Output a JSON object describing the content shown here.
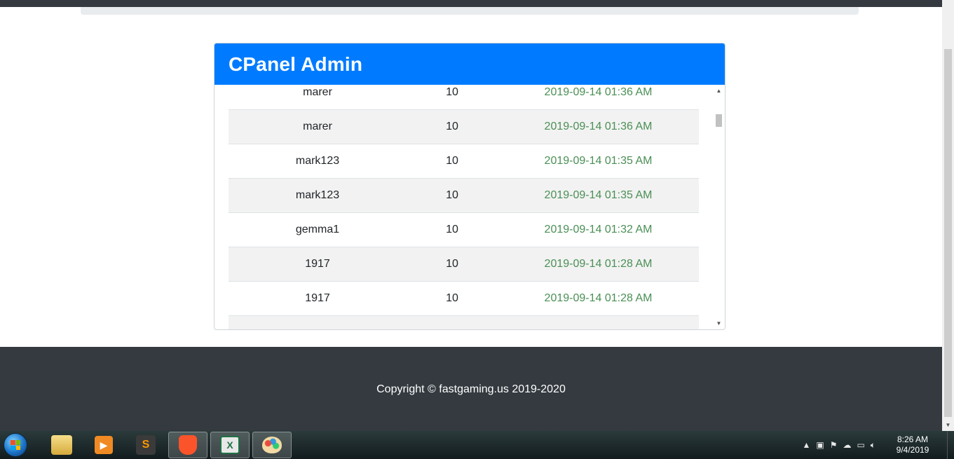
{
  "card": {
    "title": "CPanel Admin",
    "rows": [
      {
        "user": "marer",
        "value": "10",
        "date": "2019-09-14 01:36 AM"
      },
      {
        "user": "marer",
        "value": "10",
        "date": "2019-09-14 01:36 AM"
      },
      {
        "user": "mark123",
        "value": "10",
        "date": "2019-09-14 01:35 AM"
      },
      {
        "user": "mark123",
        "value": "10",
        "date": "2019-09-14 01:35 AM"
      },
      {
        "user": "gemma1",
        "value": "10",
        "date": "2019-09-14 01:32 AM"
      },
      {
        "user": "1917",
        "value": "10",
        "date": "2019-09-14 01:28 AM"
      },
      {
        "user": "1917",
        "value": "10",
        "date": "2019-09-14 01:28 AM"
      },
      {
        "user": "",
        "value": "",
        "date": ""
      }
    ]
  },
  "footer": {
    "text": "Copyright © fastgaming.us 2019-2020"
  },
  "taskbar": {
    "apps": [
      {
        "name": "file-explorer",
        "icon": "folder-icon"
      },
      {
        "name": "media-player",
        "icon": "play-icon"
      },
      {
        "name": "sublime-text",
        "icon": "sublime-icon"
      },
      {
        "name": "brave-browser",
        "icon": "brave-lion-icon"
      },
      {
        "name": "excel",
        "icon": "excel-icon"
      },
      {
        "name": "paint",
        "icon": "paint-palette-icon"
      }
    ],
    "clock_time": "8:26 AM",
    "clock_date": "9/4/2019"
  },
  "colors": {
    "header_blue": "#007bff",
    "date_green": "#4a8f55",
    "footer_dark": "#343a40"
  }
}
